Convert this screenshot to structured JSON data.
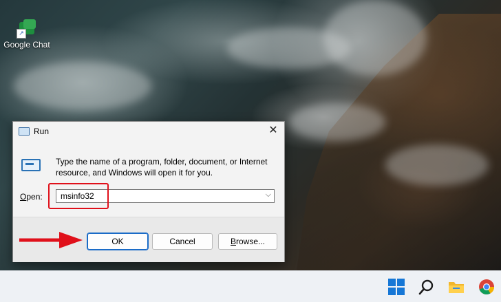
{
  "desktop": {
    "icons": [
      {
        "label": "Google Chat",
        "icon": "google-chat-icon"
      }
    ]
  },
  "dialog": {
    "title": "Run",
    "close_glyph": "✕",
    "description": "Type the name of a program, folder, document, or Internet resource, and Windows will open it for you.",
    "open_label_prefix": "O",
    "open_label_rest": "pen:",
    "open_value": "msinfo32",
    "buttons": {
      "ok": "OK",
      "cancel": "Cancel",
      "browse_prefix": "B",
      "browse_rest": "rowse..."
    }
  },
  "taskbar": {
    "icons": [
      "windows-start-icon",
      "search-icon",
      "file-explorer-icon",
      "chrome-icon"
    ]
  },
  "colors": {
    "highlight": "#e0101a",
    "accent": "#1a6bc7"
  }
}
